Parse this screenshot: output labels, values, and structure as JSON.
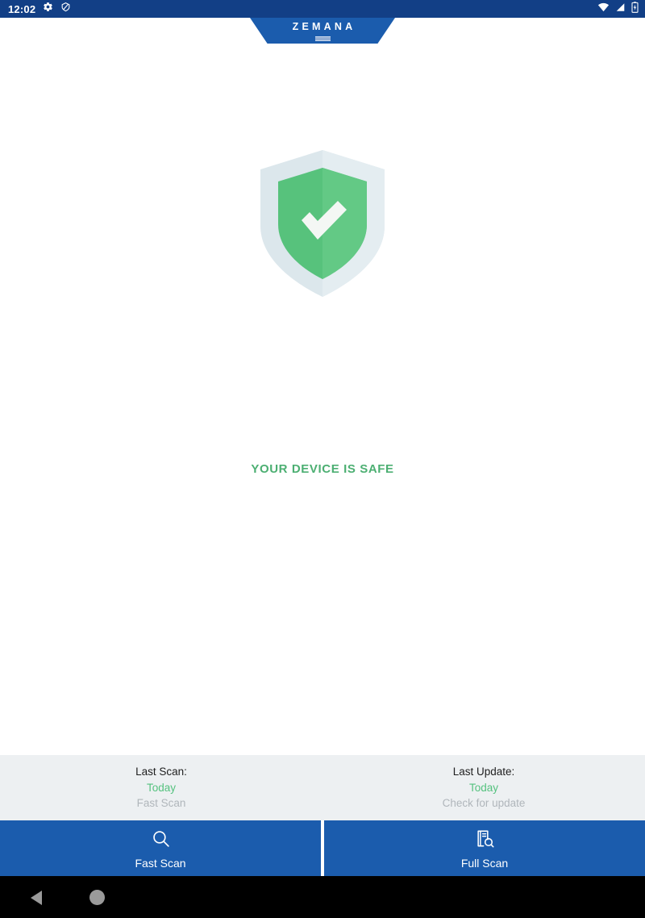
{
  "status_bar": {
    "clock": "12:02",
    "left_icons": [
      "gear-icon",
      "do-not-disturb-icon"
    ],
    "right_icons": [
      "wifi-icon",
      "cellular-signal-icon",
      "battery-icon"
    ]
  },
  "header": {
    "brand": "ZEMANA",
    "brand_color": "#1b5cad"
  },
  "main": {
    "shield_icon": "shield-check-icon",
    "shield_outer_color": "#d6e3e8",
    "shield_inner_color": "#5fc783",
    "checkmark_color": "#f4f7f4",
    "status_text": "YOUR DEVICE IS SAFE",
    "status_color": "#4caf72"
  },
  "info_panel": {
    "background": "#edf0f2",
    "columns": [
      {
        "title": "Last Scan:",
        "value": "Today",
        "value_color": "#55c27f",
        "sub": "Fast Scan",
        "sub_color": "#b0b6bb"
      },
      {
        "title": "Last Update:",
        "value": "Today",
        "value_color": "#55c27f",
        "sub": "Check for update",
        "sub_color": "#b0b6bb"
      }
    ]
  },
  "action_bar": {
    "background": "#1b5cad",
    "buttons": [
      {
        "label": "Fast Scan",
        "icon": "magnifier-icon"
      },
      {
        "label": "Full Scan",
        "icon": "document-search-icon"
      }
    ]
  },
  "nav_bar": {
    "back_icon": "back-triangle-icon",
    "home_icon": "home-circle-icon"
  }
}
